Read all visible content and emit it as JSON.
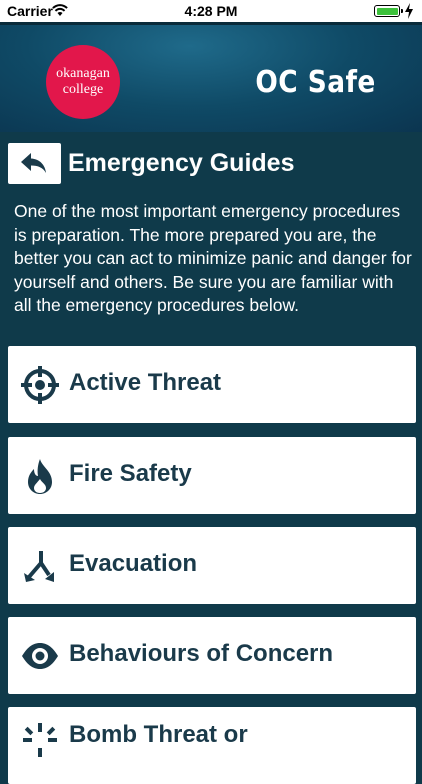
{
  "status_bar": {
    "carrier": "Carrier",
    "time": "4:28 PM"
  },
  "header": {
    "logo_line1": "okanagan",
    "logo_line2": "college",
    "app_title": "OC Safe",
    "logo_color": "#e2174b"
  },
  "page": {
    "title": "Emergency Guides",
    "intro": "One of the most important emergency procedures is preparation. The more prepared you are, the better you can act to minimize panic and danger for yourself and others. Be sure you are familiar with all the emergency procedures below."
  },
  "guides": [
    {
      "label": "Active Threat",
      "icon": "crosshair-icon"
    },
    {
      "label": "Fire Safety",
      "icon": "flame-icon"
    },
    {
      "label": "Evacuation",
      "icon": "diverging-arrows-icon"
    },
    {
      "label": "Behaviours of Concern",
      "icon": "eye-icon"
    },
    {
      "label": "Bomb Threat or",
      "icon": "burst-icon"
    }
  ],
  "colors": {
    "background": "#0f3a4a",
    "card": "#ffffff",
    "card_text": "#1a3a4a"
  }
}
